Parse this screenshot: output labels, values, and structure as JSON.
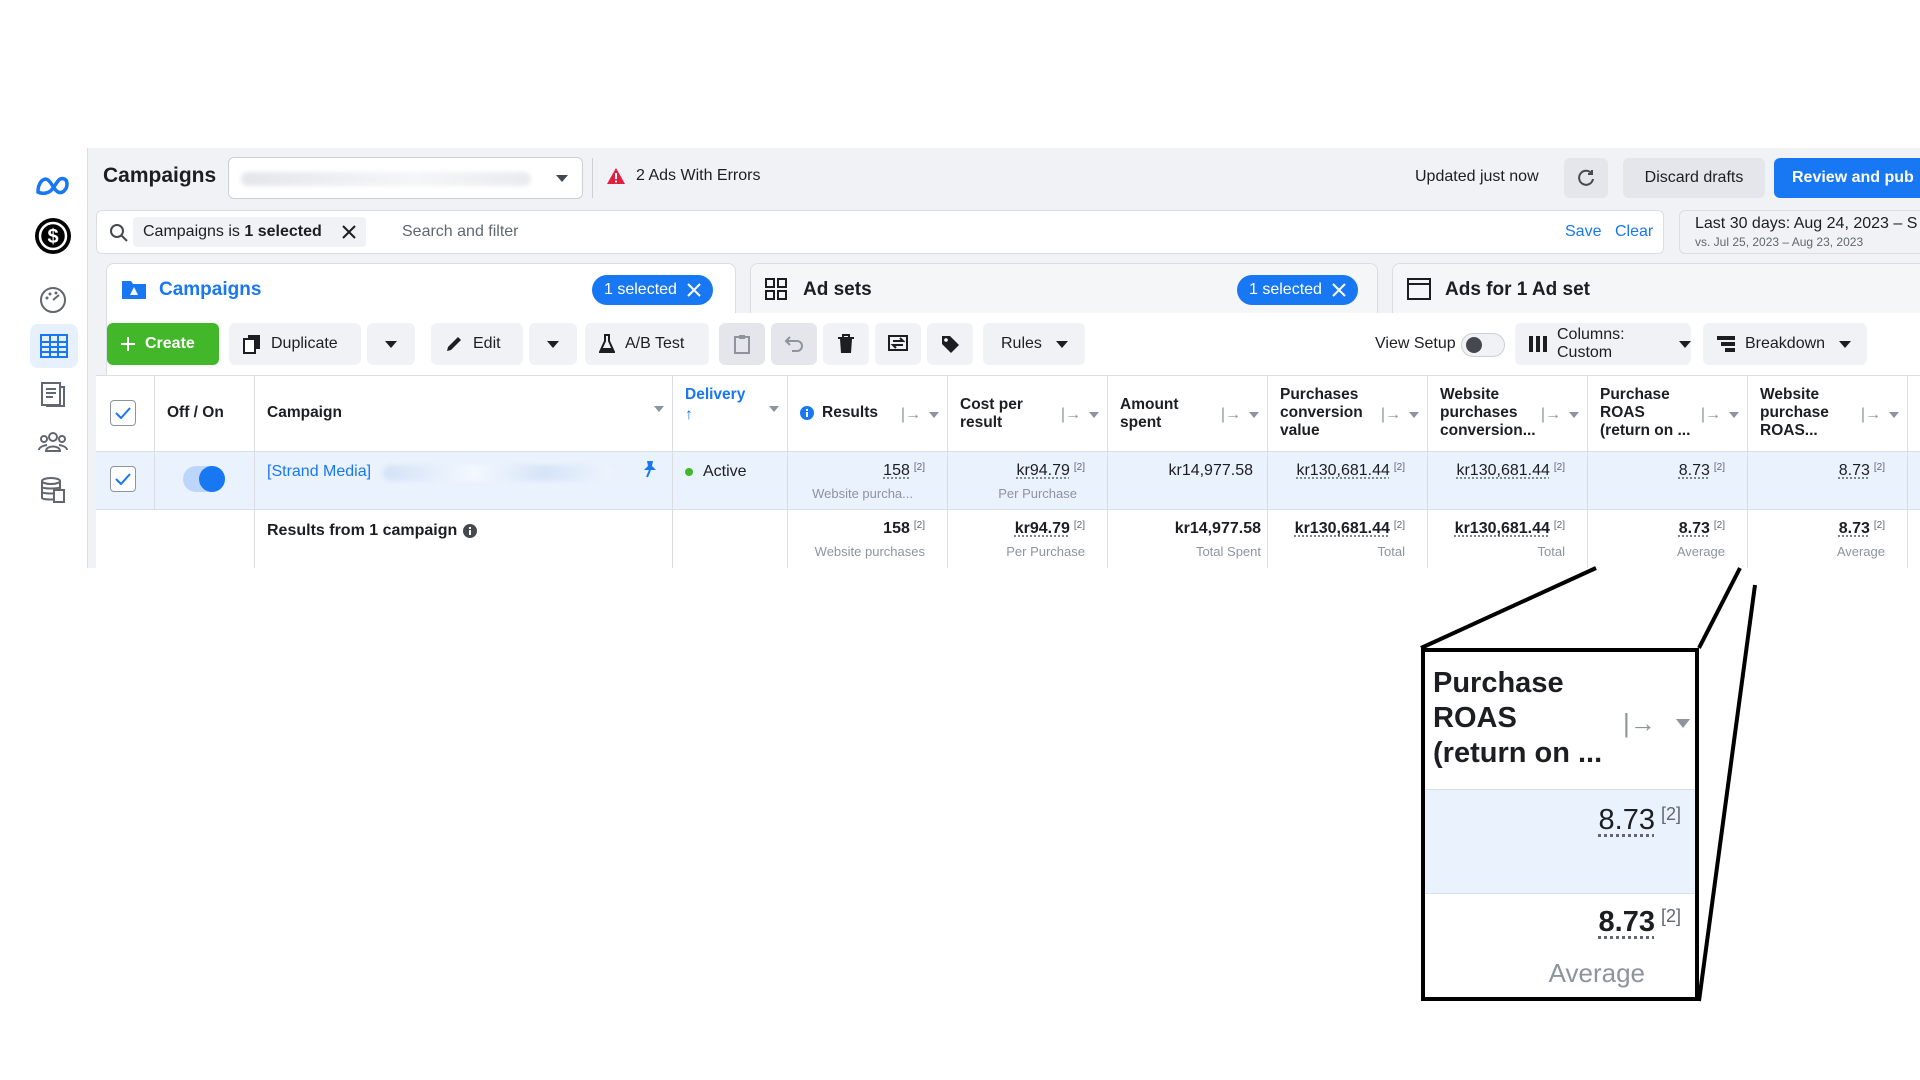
{
  "header": {
    "title": "Campaigns",
    "errors_label": "2 Ads With Errors",
    "updated_label": "Updated just now",
    "discard_label": "Discard drafts",
    "review_label": "Review and pub"
  },
  "search": {
    "filter_prefix": "Campaigns is ",
    "filter_value": "1 selected",
    "placeholder": "Search and filter",
    "save_label": "Save",
    "clear_label": "Clear"
  },
  "date_range": {
    "main": "Last 30 days: Aug 24, 2023 – S",
    "compare": "vs. Jul 25, 2023 – Aug 23, 2023"
  },
  "tabs": [
    {
      "label": "Campaigns",
      "selected": "1 selected"
    },
    {
      "label": "Ad sets",
      "selected": "1 selected"
    },
    {
      "label": "Ads for 1 Ad set"
    }
  ],
  "toolbar": {
    "create_label": "Create",
    "duplicate_label": "Duplicate",
    "edit_label": "Edit",
    "abtest_label": "A/B Test",
    "rules_label": "Rules",
    "view_setup_label": "View Setup",
    "columns_label": "Columns: Custom",
    "breakdown_label": "Breakdown"
  },
  "table": {
    "headers": {
      "offon": "Off / On",
      "campaign": "Campaign",
      "delivery": "Delivery",
      "delivery_sort": "↑",
      "results": "Results",
      "cpr": [
        "Cost per",
        "result"
      ],
      "amount": [
        "Amount",
        "spent"
      ],
      "pcv": [
        "Purchases",
        "conversion",
        "value"
      ],
      "wpcv": [
        "Website",
        "purchases",
        "conversion..."
      ],
      "roas": [
        "Purchase",
        "ROAS",
        "(return on ..."
      ],
      "wroas": [
        "Website",
        "purchase",
        "ROAS..."
      ]
    },
    "row": {
      "campaign_name": "[Strand Media]",
      "delivery": "Active",
      "results": "158",
      "results_sub": "Website purcha...",
      "cpr": "kr94.79",
      "cpr_sub": "Per Purchase",
      "amount": "kr14,977.58",
      "pcv": "kr130,681.44",
      "wpcv": "kr130,681.44",
      "roas": "8.73",
      "wroas": "8.73",
      "footnote": "[2]"
    },
    "total": {
      "label": "Results from 1 campaign",
      "results": "158",
      "results_sub": "Website purchases",
      "cpr": "kr94.79",
      "cpr_sub": "Per Purchase",
      "amount": "kr14,977.58",
      "amount_sub": "Total Spent",
      "pcv": "kr130,681.44",
      "pcv_sub": "Total",
      "wpcv": "kr130,681.44",
      "wpcv_sub": "Total",
      "roas": "8.73",
      "roas_sub": "Average",
      "wroas": "8.73",
      "wroas_sub": "Average",
      "footnote": "[2]"
    }
  },
  "zoom": {
    "title": [
      "Purchase",
      "ROAS",
      "(return on ..."
    ],
    "row_value": "8.73",
    "total_value": "8.73",
    "total_sub": "Average",
    "footnote": "[2]"
  },
  "icons": {
    "rail": [
      "meta-logo-icon",
      "dollar-badge-icon",
      "dashboard-gauge-icon",
      "campaigns-table-icon",
      "pages-icon",
      "audiences-icon",
      "billing-icon"
    ]
  },
  "colors": {
    "brand_blue": "#1877f2",
    "create_green": "#42b72a",
    "selected_row": "#eaf2fd",
    "error_red": "#e41e3f"
  }
}
